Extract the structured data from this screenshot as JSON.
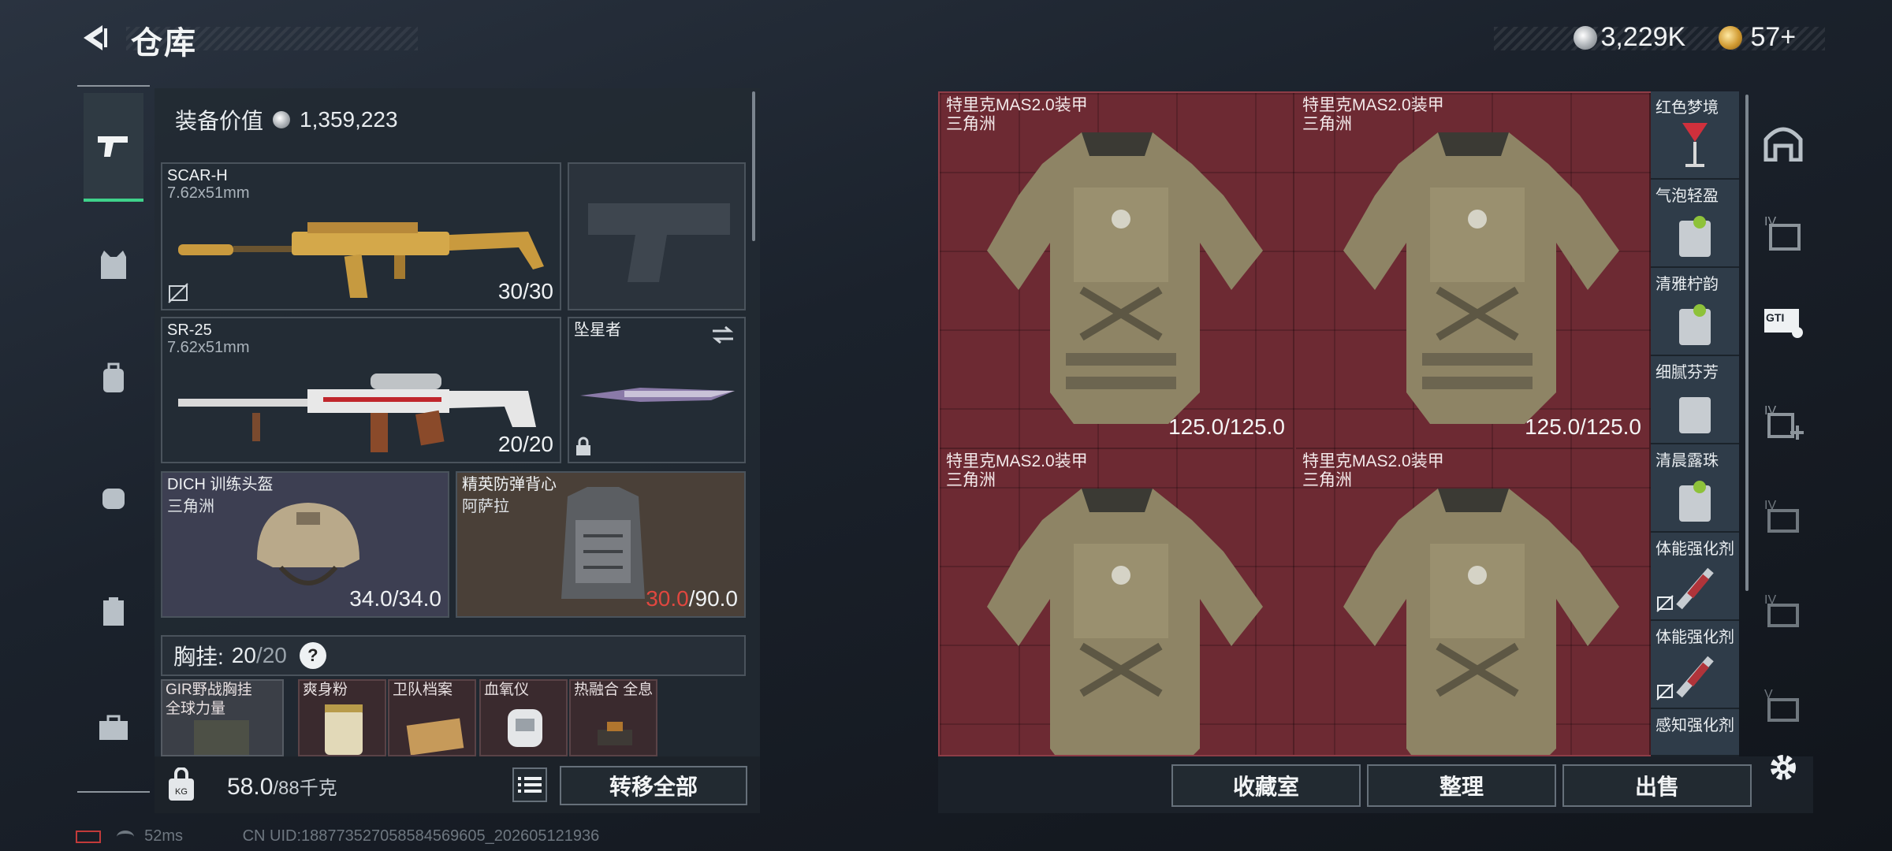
{
  "header": {
    "title": "仓库"
  },
  "currency": {
    "silver": "3,229K",
    "gold": "57+"
  },
  "loadout": {
    "value_label": "装备价值",
    "value": "1,359,223",
    "primary": {
      "name": "SCAR-H",
      "caliber": "7.62x51mm",
      "ammo": "30/30"
    },
    "secondary": {
      "name": "SR-25",
      "caliber": "7.62x51mm",
      "ammo": "20/20"
    },
    "melee": {
      "name": "坠星者"
    },
    "helmet": {
      "name": "DICH 训练头盔",
      "origin": "三角洲",
      "durability": "34.0/34.0"
    },
    "vest": {
      "name": "精英防弹背心",
      "origin": "阿萨拉",
      "durability_current": "30.0",
      "durability_max": "/90.0"
    },
    "chest": {
      "label": "胸挂:",
      "count": "20",
      "max": "/20",
      "help": "?"
    },
    "chest_items": [
      {
        "name": "GIR野战胸挂",
        "sub": "全球力量"
      },
      {
        "name": "爽身粉",
        "sub": ""
      },
      {
        "name": "卫队档案",
        "sub": ""
      },
      {
        "name": "血氧仪",
        "sub": ""
      },
      {
        "name": "热融合 全息",
        "sub": ""
      }
    ],
    "weight": {
      "current": "58.0",
      "max": "/88千克"
    },
    "transfer_all": "转移全部"
  },
  "storage": {
    "items": [
      {
        "name": "特里克MAS2.0装甲",
        "origin": "三角洲",
        "durability": "125.0/125.0"
      },
      {
        "name": "特里克MAS2.0装甲",
        "origin": "三角洲",
        "durability": "125.0/125.0"
      },
      {
        "name": "特里克MAS2.0装甲",
        "origin": "三角洲",
        "durability": ""
      },
      {
        "name": "特里克MAS2.0装甲",
        "origin": "三角洲",
        "durability": ""
      }
    ],
    "side_items": [
      "红色梦境",
      "气泡轻盈",
      "清雅柠韵",
      "细腻芬芳",
      "清晨露珠",
      "体能强化剂",
      "体能强化剂",
      "感知强化剂"
    ],
    "buttons": {
      "collection": "收藏室",
      "organize": "整理",
      "sell": "出售"
    }
  },
  "footer": {
    "ping": "52ms",
    "uid": "CN UID:188773527058584569605_202605121936"
  },
  "colors": {
    "accent_green": "#3fd28b",
    "storage_bg": "#6d2a33",
    "low_durability": "#e0473f"
  }
}
